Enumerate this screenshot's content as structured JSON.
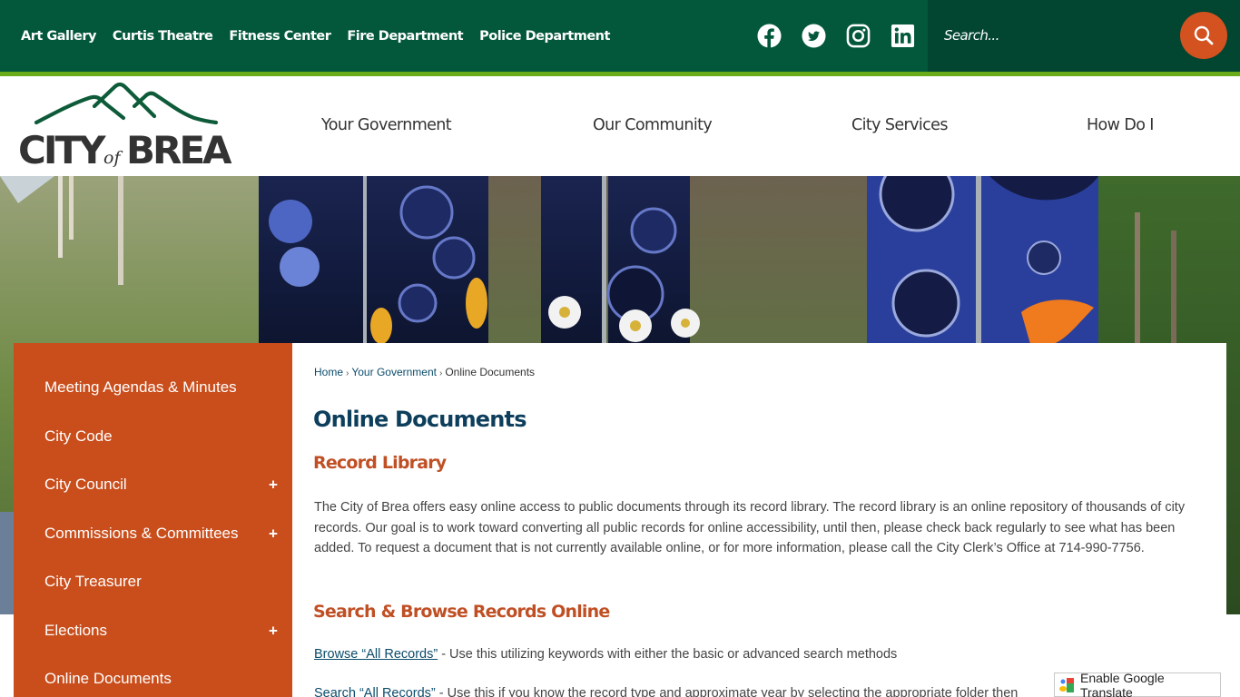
{
  "topbar": {
    "quick_links": [
      "Art Gallery",
      "Curtis Theatre",
      "Fitness Center",
      "Fire Department",
      "Police Department"
    ],
    "social": [
      {
        "name": "facebook-icon"
      },
      {
        "name": "twitter-icon"
      },
      {
        "name": "instagram-icon"
      },
      {
        "name": "linkedin-icon"
      }
    ],
    "search": {
      "placeholder": "Search...",
      "value": ""
    }
  },
  "header": {
    "logo": {
      "line1": "CITY",
      "of": "of",
      "line2": "BREA"
    },
    "nav": [
      "Your Government",
      "Our Community",
      "City Services",
      "How Do I"
    ]
  },
  "sidebar": {
    "items": [
      {
        "label": "Meeting Agendas & Minutes",
        "expandable": false
      },
      {
        "label": "City Code",
        "expandable": false
      },
      {
        "label": "City Council",
        "expandable": true
      },
      {
        "label": "Commissions & Committees",
        "expandable": true
      },
      {
        "label": "City Treasurer",
        "expandable": false
      },
      {
        "label": "Elections",
        "expandable": true
      },
      {
        "label": "Online Documents",
        "expandable": false
      }
    ],
    "expand_symbol": "+"
  },
  "breadcrumb": {
    "items": [
      "Home",
      "Your Government",
      "Online Documents"
    ],
    "separator": "›"
  },
  "main": {
    "title": "Online Documents",
    "section1": {
      "heading": "Record Library",
      "body": "The City of Brea offers easy online access to public documents through its record library. The record library is an online repository of thousands of city records. Our goal is to work toward converting all public records for online accessibility, until then, please check back regularly to see what has been added. To request a document that is not currently available online, or for more information, please call the City Clerk’s Office at 714-990-7756."
    },
    "section2": {
      "heading": "Search & Browse Records Online",
      "items": [
        {
          "link": "Browse “All Records”",
          "text": " - Use this utilizing keywords with either the basic or advanced search methods"
        },
        {
          "link": "Search “All Records”",
          "text": " - Use this if you know the record type and approximate year by selecting the appropriate folder then"
        }
      ]
    }
  },
  "translate": {
    "label": "Enable Google Translate"
  },
  "colors": {
    "top_bar": "#03583b",
    "search_bg": "#024530",
    "accent_green": "#6aab1a",
    "accent_orange": "#c94e1c",
    "title_blue": "#0d3e5c",
    "heading_orange": "#c04f24"
  }
}
